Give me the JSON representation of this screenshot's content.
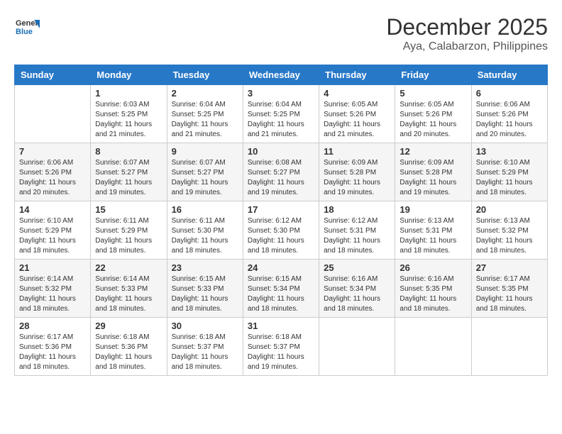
{
  "header": {
    "logo_line1": "General",
    "logo_line2": "Blue",
    "month": "December 2025",
    "location": "Aya, Calabarzon, Philippines"
  },
  "columns": [
    "Sunday",
    "Monday",
    "Tuesday",
    "Wednesday",
    "Thursday",
    "Friday",
    "Saturday"
  ],
  "weeks": [
    [
      {
        "day": "",
        "info": ""
      },
      {
        "day": "1",
        "info": "Sunrise: 6:03 AM\nSunset: 5:25 PM\nDaylight: 11 hours\nand 21 minutes."
      },
      {
        "day": "2",
        "info": "Sunrise: 6:04 AM\nSunset: 5:25 PM\nDaylight: 11 hours\nand 21 minutes."
      },
      {
        "day": "3",
        "info": "Sunrise: 6:04 AM\nSunset: 5:25 PM\nDaylight: 11 hours\nand 21 minutes."
      },
      {
        "day": "4",
        "info": "Sunrise: 6:05 AM\nSunset: 5:26 PM\nDaylight: 11 hours\nand 21 minutes."
      },
      {
        "day": "5",
        "info": "Sunrise: 6:05 AM\nSunset: 5:26 PM\nDaylight: 11 hours\nand 20 minutes."
      },
      {
        "day": "6",
        "info": "Sunrise: 6:06 AM\nSunset: 5:26 PM\nDaylight: 11 hours\nand 20 minutes."
      }
    ],
    [
      {
        "day": "7",
        "info": "Sunrise: 6:06 AM\nSunset: 5:26 PM\nDaylight: 11 hours\nand 20 minutes."
      },
      {
        "day": "8",
        "info": "Sunrise: 6:07 AM\nSunset: 5:27 PM\nDaylight: 11 hours\nand 19 minutes."
      },
      {
        "day": "9",
        "info": "Sunrise: 6:07 AM\nSunset: 5:27 PM\nDaylight: 11 hours\nand 19 minutes."
      },
      {
        "day": "10",
        "info": "Sunrise: 6:08 AM\nSunset: 5:27 PM\nDaylight: 11 hours\nand 19 minutes."
      },
      {
        "day": "11",
        "info": "Sunrise: 6:09 AM\nSunset: 5:28 PM\nDaylight: 11 hours\nand 19 minutes."
      },
      {
        "day": "12",
        "info": "Sunrise: 6:09 AM\nSunset: 5:28 PM\nDaylight: 11 hours\nand 19 minutes."
      },
      {
        "day": "13",
        "info": "Sunrise: 6:10 AM\nSunset: 5:29 PM\nDaylight: 11 hours\nand 18 minutes."
      }
    ],
    [
      {
        "day": "14",
        "info": "Sunrise: 6:10 AM\nSunset: 5:29 PM\nDaylight: 11 hours\nand 18 minutes."
      },
      {
        "day": "15",
        "info": "Sunrise: 6:11 AM\nSunset: 5:29 PM\nDaylight: 11 hours\nand 18 minutes."
      },
      {
        "day": "16",
        "info": "Sunrise: 6:11 AM\nSunset: 5:30 PM\nDaylight: 11 hours\nand 18 minutes."
      },
      {
        "day": "17",
        "info": "Sunrise: 6:12 AM\nSunset: 5:30 PM\nDaylight: 11 hours\nand 18 minutes."
      },
      {
        "day": "18",
        "info": "Sunrise: 6:12 AM\nSunset: 5:31 PM\nDaylight: 11 hours\nand 18 minutes."
      },
      {
        "day": "19",
        "info": "Sunrise: 6:13 AM\nSunset: 5:31 PM\nDaylight: 11 hours\nand 18 minutes."
      },
      {
        "day": "20",
        "info": "Sunrise: 6:13 AM\nSunset: 5:32 PM\nDaylight: 11 hours\nand 18 minutes."
      }
    ],
    [
      {
        "day": "21",
        "info": "Sunrise: 6:14 AM\nSunset: 5:32 PM\nDaylight: 11 hours\nand 18 minutes."
      },
      {
        "day": "22",
        "info": "Sunrise: 6:14 AM\nSunset: 5:33 PM\nDaylight: 11 hours\nand 18 minutes."
      },
      {
        "day": "23",
        "info": "Sunrise: 6:15 AM\nSunset: 5:33 PM\nDaylight: 11 hours\nand 18 minutes."
      },
      {
        "day": "24",
        "info": "Sunrise: 6:15 AM\nSunset: 5:34 PM\nDaylight: 11 hours\nand 18 minutes."
      },
      {
        "day": "25",
        "info": "Sunrise: 6:16 AM\nSunset: 5:34 PM\nDaylight: 11 hours\nand 18 minutes."
      },
      {
        "day": "26",
        "info": "Sunrise: 6:16 AM\nSunset: 5:35 PM\nDaylight: 11 hours\nand 18 minutes."
      },
      {
        "day": "27",
        "info": "Sunrise: 6:17 AM\nSunset: 5:35 PM\nDaylight: 11 hours\nand 18 minutes."
      }
    ],
    [
      {
        "day": "28",
        "info": "Sunrise: 6:17 AM\nSunset: 5:36 PM\nDaylight: 11 hours\nand 18 minutes."
      },
      {
        "day": "29",
        "info": "Sunrise: 6:18 AM\nSunset: 5:36 PM\nDaylight: 11 hours\nand 18 minutes."
      },
      {
        "day": "30",
        "info": "Sunrise: 6:18 AM\nSunset: 5:37 PM\nDaylight: 11 hours\nand 18 minutes."
      },
      {
        "day": "31",
        "info": "Sunrise: 6:18 AM\nSunset: 5:37 PM\nDaylight: 11 hours\nand 19 minutes."
      },
      {
        "day": "",
        "info": ""
      },
      {
        "day": "",
        "info": ""
      },
      {
        "day": "",
        "info": ""
      }
    ]
  ]
}
